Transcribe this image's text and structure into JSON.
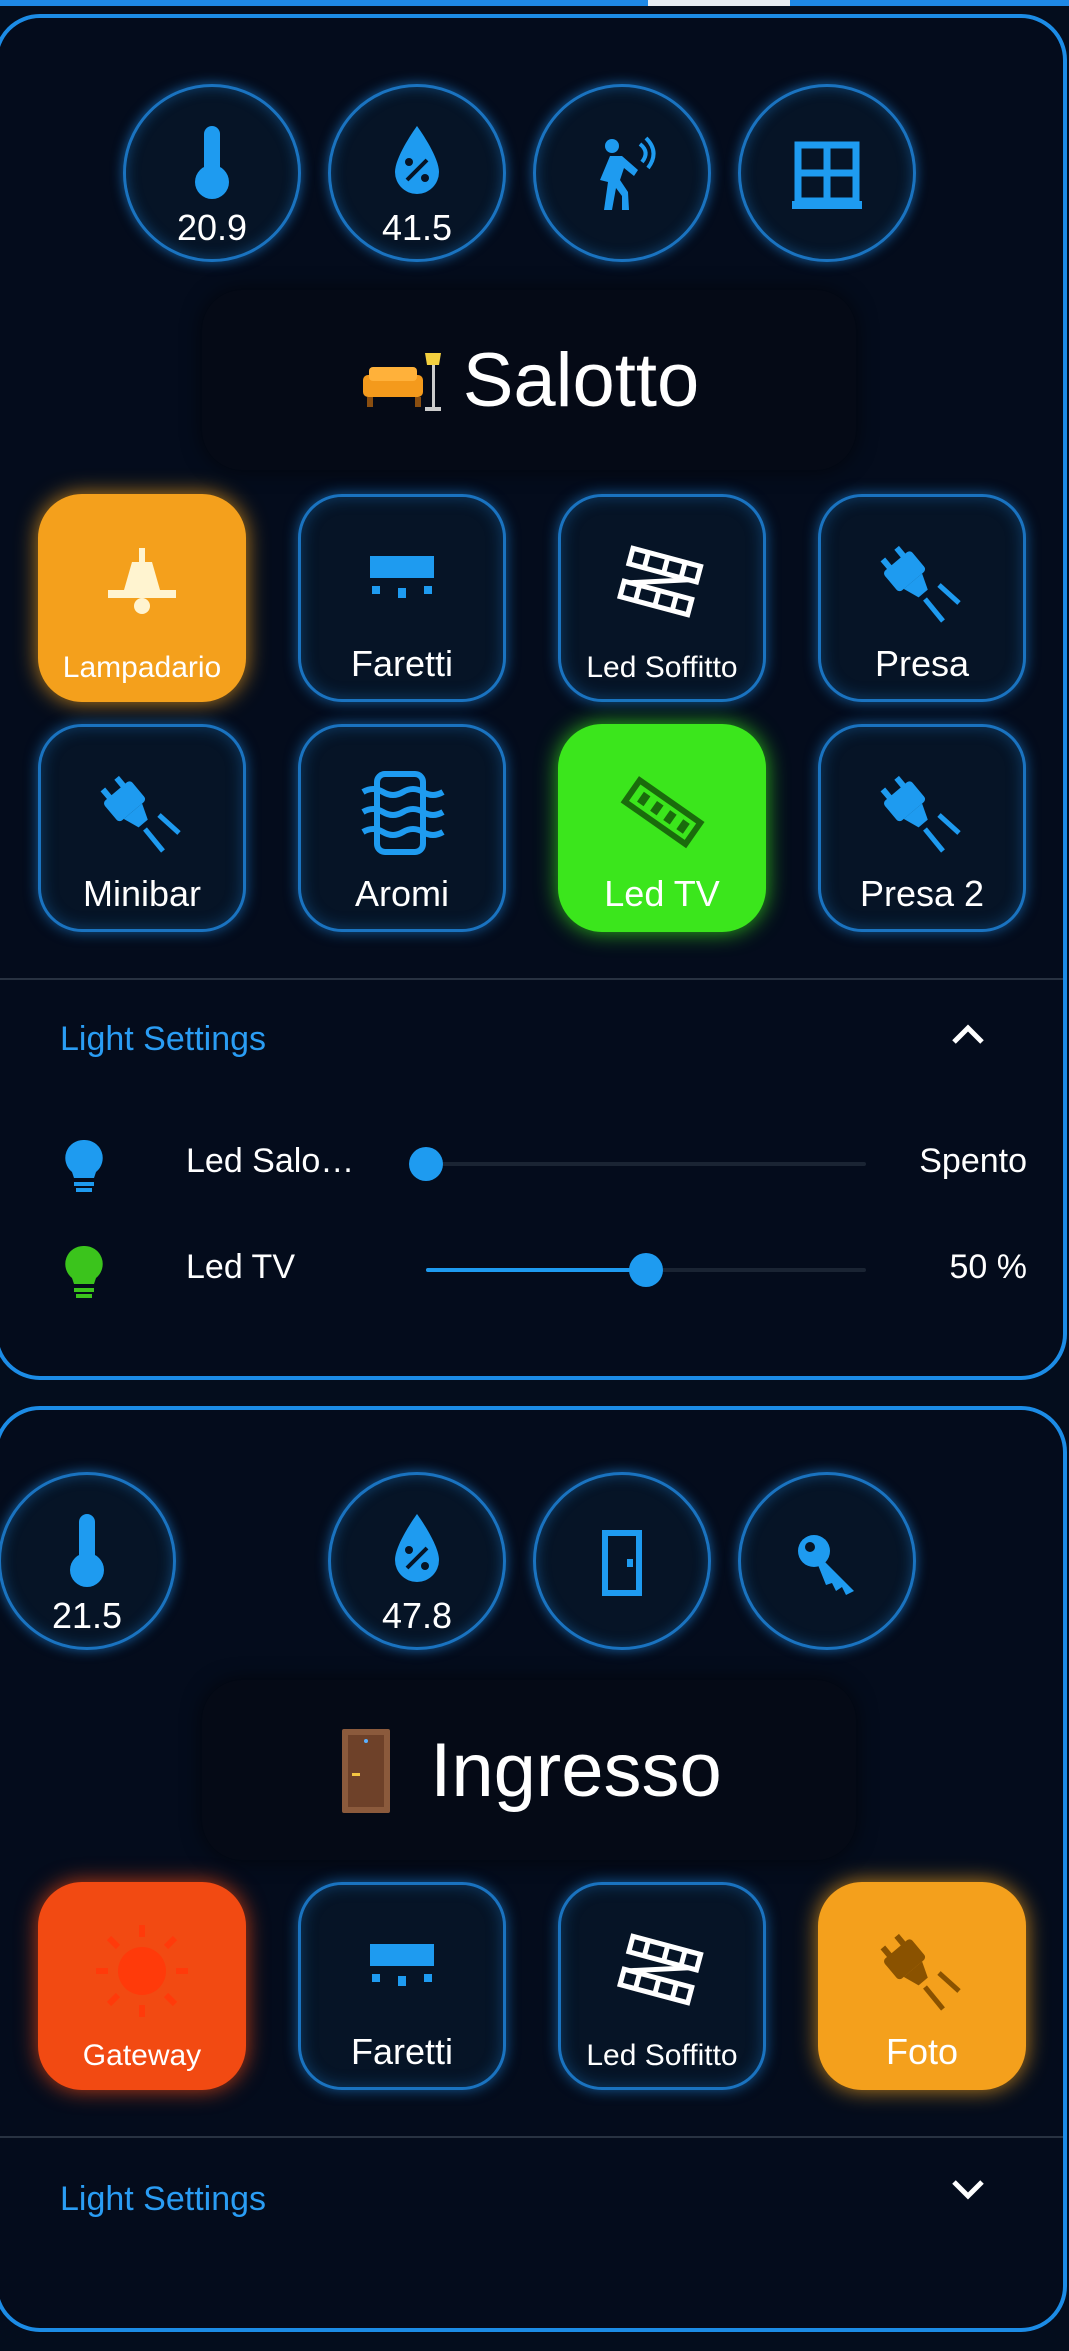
{
  "colors": {
    "accent": "#1c8ce6",
    "orange": "#f4a01c",
    "green": "#3be61c",
    "red": "#f24a12",
    "bg": "#040c1c"
  },
  "rooms": [
    {
      "name": "Salotto",
      "emoji": "🛋️",
      "sensors": [
        {
          "icon": "thermometer-icon",
          "value": "20.9"
        },
        {
          "icon": "humidity-icon",
          "value": "41.5"
        },
        {
          "icon": "motion-icon",
          "value": ""
        },
        {
          "icon": "window-icon",
          "value": ""
        }
      ],
      "buttons": [
        {
          "label": "Lampadario",
          "icon": "ceiling-lamp-icon",
          "state": "on"
        },
        {
          "label": "Faretti",
          "icon": "spotlight-icon",
          "state": "off"
        },
        {
          "label": "Led Soffitto",
          "icon": "led-strip-icon",
          "state": "off"
        },
        {
          "label": "Presa",
          "icon": "plug-icon",
          "state": "off"
        },
        {
          "label": "Minibar",
          "icon": "plug-icon",
          "state": "off"
        },
        {
          "label": "Aromi",
          "icon": "scent-icon",
          "state": "off"
        },
        {
          "label": "Led TV",
          "icon": "led-strip-icon",
          "state": "on"
        },
        {
          "label": "Presa 2",
          "icon": "plug-icon",
          "state": "off"
        }
      ],
      "light_settings": {
        "title": "Light Settings",
        "expanded": true,
        "lights": [
          {
            "name": "Led Salo…",
            "value": "Spento",
            "level": 0,
            "color": "#1e9bf0"
          },
          {
            "name": "Led TV",
            "value": "50 %",
            "level": 0.5,
            "color": "#3bc41c"
          }
        ]
      }
    },
    {
      "name": "Ingresso",
      "emoji": "🚪",
      "sensors": [
        {
          "icon": "thermometer-icon",
          "value": "21.5"
        },
        {
          "icon": "humidity-icon",
          "value": "47.8"
        },
        {
          "icon": "door-icon",
          "value": ""
        },
        {
          "icon": "key-icon",
          "value": ""
        }
      ],
      "buttons": [
        {
          "label": "Gateway",
          "icon": "sun-icon",
          "state": "on"
        },
        {
          "label": "Faretti",
          "icon": "spotlight-icon",
          "state": "off"
        },
        {
          "label": "Led Soffitto",
          "icon": "led-strip-icon",
          "state": "off"
        },
        {
          "label": "Foto",
          "icon": "plug-icon",
          "state": "on"
        }
      ],
      "light_settings": {
        "title": "Light Settings",
        "expanded": false
      }
    }
  ]
}
